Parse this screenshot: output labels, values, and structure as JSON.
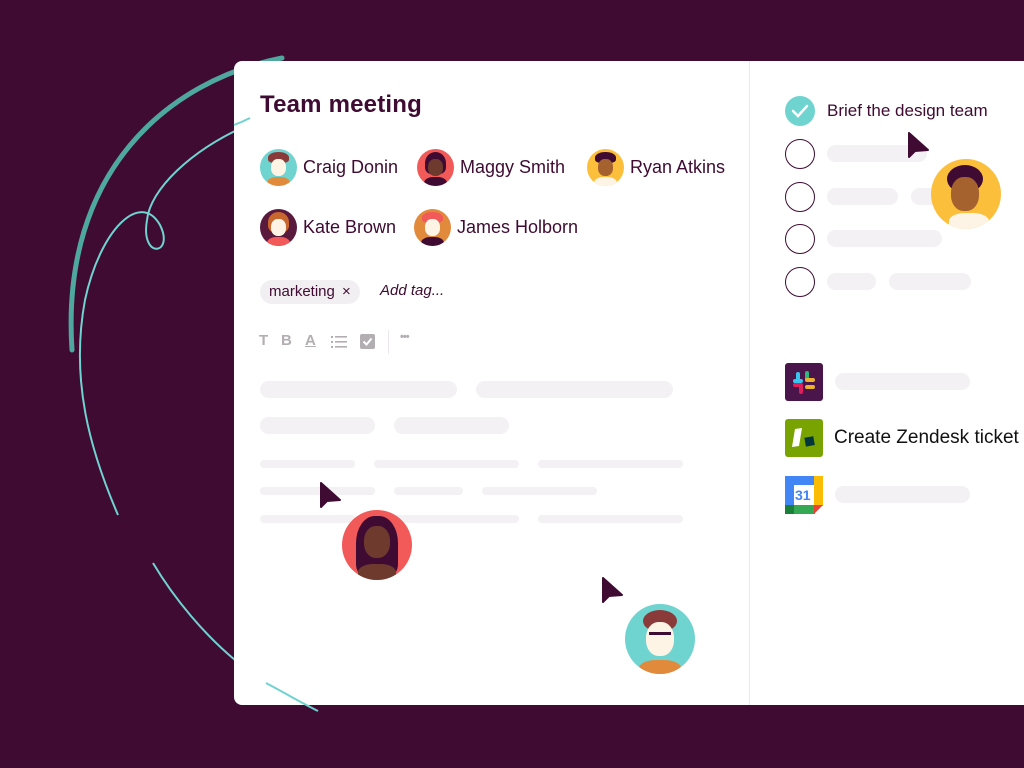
{
  "page": {
    "title": "Team meeting",
    "colors": {
      "background": "#3f0b32",
      "text": "#3f0b32",
      "accent_teal": "#6fd3cf",
      "placeholder": "#f3f1f3"
    }
  },
  "participants": [
    {
      "name": "Craig Donin",
      "avatar_color": "#6fd3cf"
    },
    {
      "name": "Maggy Smith",
      "avatar_color": "#f25a5a"
    },
    {
      "name": "Ryan Atkins",
      "avatar_color": "#fbbf3c"
    },
    {
      "name": "Kate Brown",
      "avatar_color": "#5a1a3d"
    },
    {
      "name": "James Holborn",
      "avatar_color": "#e28a3c"
    }
  ],
  "tags": {
    "items": [
      {
        "label": "marketing",
        "remove_icon": "×"
      }
    ],
    "add_placeholder": "Add tag..."
  },
  "toolbar": {
    "text_icon": "T",
    "bold_icon": "B",
    "color_icon": "A",
    "list_icon": "list",
    "checkbox_icon": "checkbox",
    "more_icon": "•••"
  },
  "tasks": [
    {
      "label": "Brief the design team",
      "done": true
    },
    {
      "label": "",
      "done": false
    },
    {
      "label": "",
      "done": false
    },
    {
      "label": "",
      "done": false
    },
    {
      "label": "",
      "done": false
    }
  ],
  "integrations": [
    {
      "app": "Slack",
      "label": ""
    },
    {
      "app": "Zendesk",
      "label": "Create Zendesk ticket"
    },
    {
      "app": "Google Calendar",
      "label": "",
      "calendar_day": "31"
    }
  ]
}
